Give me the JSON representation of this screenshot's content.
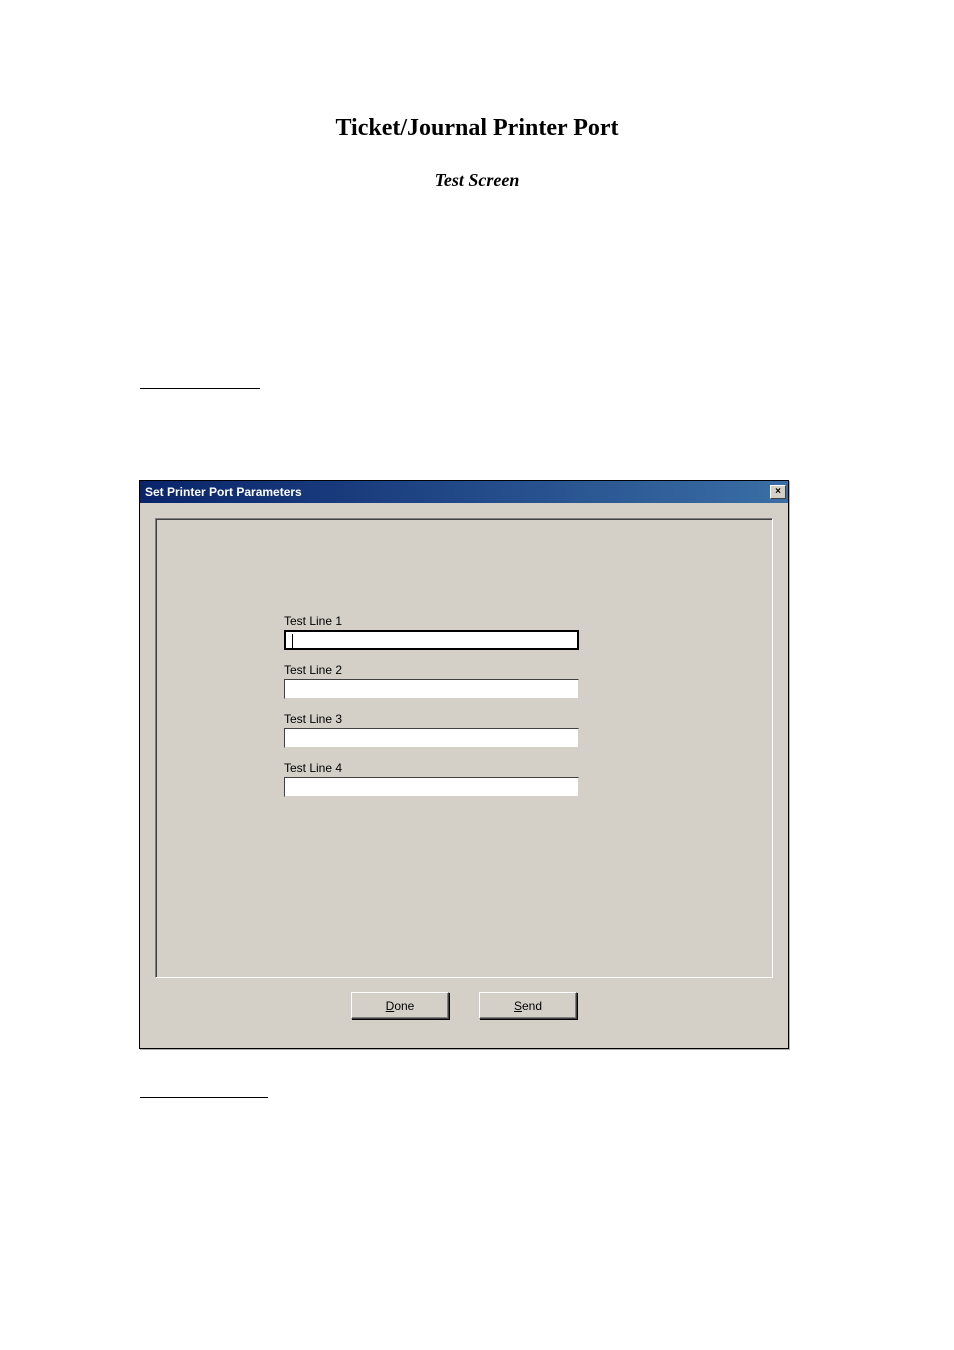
{
  "page": {
    "title": "Ticket/Journal Printer Port",
    "subtitle": "Test Screen"
  },
  "dialog": {
    "title": "Set Printer Port Parameters",
    "close_label": "×",
    "fields": [
      {
        "label": "Test Line 1",
        "value": ""
      },
      {
        "label": "Test Line 2",
        "value": ""
      },
      {
        "label": "Test Line 3",
        "value": ""
      },
      {
        "label": "Test Line 4",
        "value": ""
      }
    ],
    "buttons": {
      "done": {
        "mnemonic": "D",
        "rest": "one"
      },
      "send": {
        "mnemonic": "S",
        "rest": "end"
      }
    }
  }
}
